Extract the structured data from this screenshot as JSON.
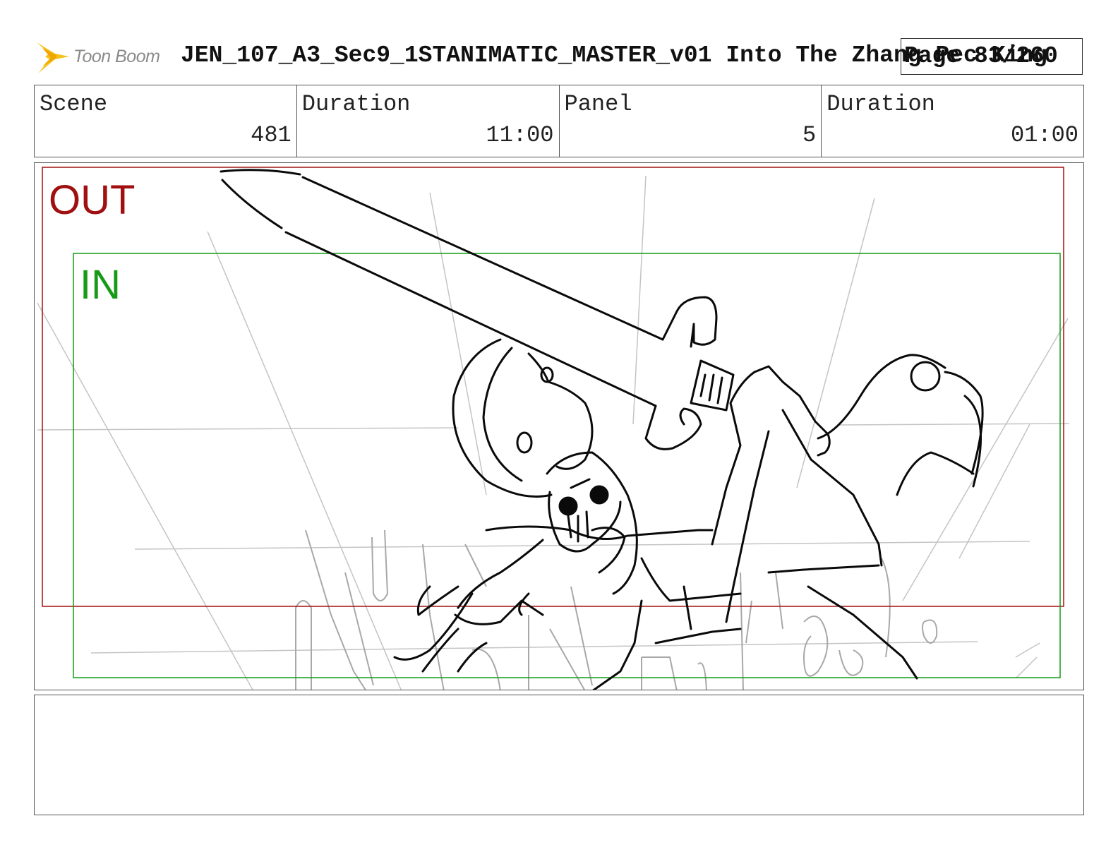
{
  "header": {
    "logo_text": "Toon Boom",
    "project_title": "JEN_107_A3_Sec9_1STANIMATIC_MASTER_v01  Into The Zhang Pec King",
    "page_label": "Page 83/260"
  },
  "info": {
    "scene_label": "Scene",
    "scene_value": "481",
    "scene_duration_label": "Duration",
    "scene_duration_value": "11:00",
    "panel_label": "Panel",
    "panel_value": "5",
    "panel_duration_label": "Duration",
    "panel_duration_value": "01:00"
  },
  "frames": {
    "out_label": "OUT",
    "in_label": "IN",
    "out_color": "#a01010",
    "in_color": "#159b15"
  },
  "notes": {
    "text": ""
  }
}
